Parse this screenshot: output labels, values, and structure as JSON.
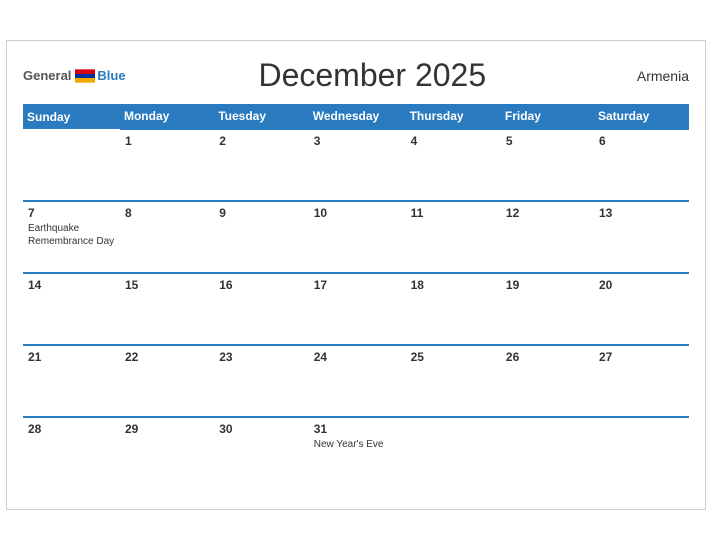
{
  "header": {
    "logo": {
      "general": "General",
      "blue": "Blue"
    },
    "title": "December 2025",
    "country": "Armenia"
  },
  "weekdays": [
    "Sunday",
    "Monday",
    "Tuesday",
    "Wednesday",
    "Thursday",
    "Friday",
    "Saturday"
  ],
  "weeks": [
    [
      {
        "day": "",
        "event": ""
      },
      {
        "day": "1",
        "event": ""
      },
      {
        "day": "2",
        "event": ""
      },
      {
        "day": "3",
        "event": ""
      },
      {
        "day": "4",
        "event": ""
      },
      {
        "day": "5",
        "event": ""
      },
      {
        "day": "6",
        "event": ""
      }
    ],
    [
      {
        "day": "7",
        "event": "Earthquake Remembrance Day"
      },
      {
        "day": "8",
        "event": ""
      },
      {
        "day": "9",
        "event": ""
      },
      {
        "day": "10",
        "event": ""
      },
      {
        "day": "11",
        "event": ""
      },
      {
        "day": "12",
        "event": ""
      },
      {
        "day": "13",
        "event": ""
      }
    ],
    [
      {
        "day": "14",
        "event": ""
      },
      {
        "day": "15",
        "event": ""
      },
      {
        "day": "16",
        "event": ""
      },
      {
        "day": "17",
        "event": ""
      },
      {
        "day": "18",
        "event": ""
      },
      {
        "day": "19",
        "event": ""
      },
      {
        "day": "20",
        "event": ""
      }
    ],
    [
      {
        "day": "21",
        "event": ""
      },
      {
        "day": "22",
        "event": ""
      },
      {
        "day": "23",
        "event": ""
      },
      {
        "day": "24",
        "event": ""
      },
      {
        "day": "25",
        "event": ""
      },
      {
        "day": "26",
        "event": ""
      },
      {
        "day": "27",
        "event": ""
      }
    ],
    [
      {
        "day": "28",
        "event": ""
      },
      {
        "day": "29",
        "event": ""
      },
      {
        "day": "30",
        "event": ""
      },
      {
        "day": "31",
        "event": "New Year's Eve"
      },
      {
        "day": "",
        "event": ""
      },
      {
        "day": "",
        "event": ""
      },
      {
        "day": "",
        "event": ""
      }
    ]
  ]
}
